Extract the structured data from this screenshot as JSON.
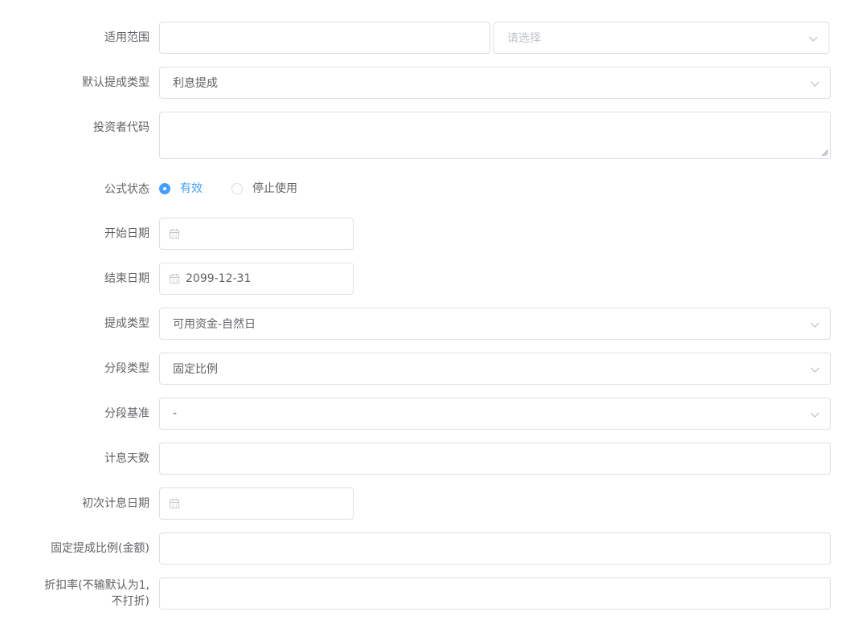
{
  "form": {
    "scope": {
      "label": "适用范围",
      "input_value": "",
      "select_placeholder": "请选择"
    },
    "default_commission_type": {
      "label": "默认提成类型",
      "value": "利息提成"
    },
    "investor_code": {
      "label": "投资者代码",
      "value": ""
    },
    "formula_status": {
      "label": "公式状态",
      "options": [
        {
          "label": "有效",
          "checked": true
        },
        {
          "label": "停止使用",
          "checked": false
        }
      ]
    },
    "start_date": {
      "label": "开始日期",
      "value": ""
    },
    "end_date": {
      "label": "结束日期",
      "value": "2099-12-31"
    },
    "commission_type": {
      "label": "提成类型",
      "value": "可用资金-自然日"
    },
    "segment_type": {
      "label": "分段类型",
      "value": "固定比例"
    },
    "segment_basis": {
      "label": "分段基准",
      "value": "-"
    },
    "interest_days": {
      "label": "计息天数",
      "value": ""
    },
    "first_interest_date": {
      "label": "初次计息日期",
      "value": ""
    },
    "fixed_ratio": {
      "label": "固定提成比例(金额)",
      "value": ""
    },
    "discount_rate": {
      "label_line1": "折扣率(不输默认为1,",
      "label_line2": "不打折)",
      "value": ""
    }
  },
  "colors": {
    "accent": "#409eff",
    "border": "#dcdfe6",
    "text": "#606266",
    "placeholder": "#c0c4cc"
  },
  "icons": {
    "select": "chevron-down-icon",
    "date": "calendar-icon"
  }
}
